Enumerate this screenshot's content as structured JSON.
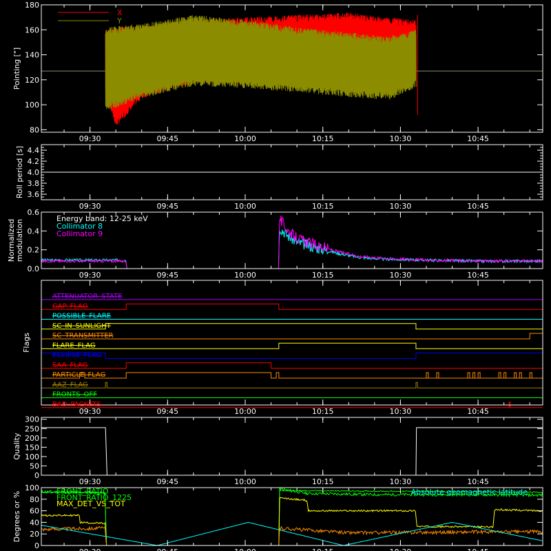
{
  "x_axis": {
    "ticks": [
      "09:30",
      "09:45",
      "10:00",
      "10:15",
      "10:30",
      "10:45"
    ],
    "tick_minutes": [
      570,
      585,
      600,
      615,
      630,
      645
    ],
    "xlim_minutes": [
      560.6,
      657.5
    ]
  },
  "colors": {
    "red": "#ff0000",
    "olive": "#8c8c00",
    "white": "#ffffff",
    "cyan": "#00ffff",
    "magenta": "#ff00ff",
    "yellow": "#ffff00",
    "orange": "#ff8c00",
    "blue": "#0000ff",
    "green": "#00ff00",
    "purple": "#b000ff",
    "dark_olive": "#a08000",
    "axis": "#ffffff"
  },
  "panels": {
    "pointing": {
      "ylabel": "Pointing [\"]",
      "yticks": [
        "80",
        "100",
        "120",
        "140",
        "160",
        "180"
      ],
      "ylim": [
        78,
        180
      ],
      "legend": [
        {
          "label": "X",
          "color": "#ff0000"
        },
        {
          "label": "Y",
          "color": "#8c8c00"
        }
      ]
    },
    "roll": {
      "ylabel": "Roll period [s]",
      "yticks": [
        "3.6",
        "3.8",
        "4.0",
        "4.2",
        "4.4"
      ],
      "ylim": [
        3.5,
        4.5
      ]
    },
    "modulation": {
      "ylabel_line1": "Normalized",
      "ylabel_line2": "modulation",
      "yticks": [
        "0.0",
        "0.2",
        "0.4",
        "0.6"
      ],
      "ylim": [
        0,
        0.6
      ],
      "legend": [
        {
          "label": "Energy band: 12-25 keV",
          "color": "#ffffff"
        },
        {
          "label": "Collimator 8",
          "color": "#00ffff"
        },
        {
          "label": "Collimator 9",
          "color": "#ff00ff"
        }
      ]
    },
    "flags": {
      "ylabel": "Flags",
      "items": [
        {
          "label": "ATTENUATOR_STATE",
          "color": "#b000ff"
        },
        {
          "label": "GAP_FLAG",
          "color": "#ff0000"
        },
        {
          "label": "POSSIBLE_FLARE",
          "color": "#00ffff"
        },
        {
          "label": "SC_IN_SUNLIGHT",
          "color": "#ffff00"
        },
        {
          "label": "SC_TRANSMITTER",
          "color": "#ff8c00"
        },
        {
          "label": "FLARE_FLAG",
          "color": "#ffff00"
        },
        {
          "label": "ECLIPSE_FLAG",
          "color": "#0000ff"
        },
        {
          "label": "SAA_FLAG",
          "color": "#ff0000"
        },
        {
          "label": "PARTICLE_FLAG",
          "color": "#ff8c00"
        },
        {
          "label": "AAZ_FLAG",
          "color": "#a08000"
        },
        {
          "label": "FRONTS_OFF",
          "color": "#00ff00"
        },
        {
          "label": "BAD_PACKETS",
          "color": "#ff0000"
        }
      ]
    },
    "quality": {
      "ylabel": "Quality",
      "yticks": [
        "0",
        "50",
        "100",
        "150",
        "200",
        "250",
        "300"
      ],
      "ylim": [
        0,
        310
      ]
    },
    "ratio": {
      "ylabel": "Degrees or %",
      "yticks": [
        "0",
        "20",
        "40",
        "60",
        "80",
        "100"
      ],
      "ylim": [
        0,
        100
      ],
      "legend": [
        {
          "label": "FRONT_RATIO",
          "color": "#00ff00"
        },
        {
          "label": "FRONT_RATIO_1225",
          "color": "#00ff00"
        },
        {
          "label": "MAX_DET_VS_TOT",
          "color": "#ffff00"
        }
      ],
      "annotation": {
        "label": "Absolute geomagnetic latitude",
        "color": "#00ffff"
      }
    }
  },
  "chart_data": [
    {
      "type": "line",
      "ylabel": "Pointing [\"]",
      "ylim": [
        78,
        180
      ],
      "x_unit": "minutes since 00:00",
      "series": [
        {
          "name": "X",
          "envelope_x": [
            573,
            575,
            580,
            590,
            600,
            610,
            620,
            627,
            633
          ],
          "envelope_hi": [
            160,
            162,
            163,
            168,
            170,
            172,
            174,
            170,
            168
          ],
          "envelope_lo": [
            108,
            82,
            105,
            118,
            117,
            120,
            122,
            128,
            121
          ]
        },
        {
          "name": "Y",
          "envelope_x": [
            573,
            580,
            590,
            600,
            610,
            620,
            628,
            633
          ],
          "envelope_hi": [
            162,
            165,
            172,
            168,
            162,
            158,
            155,
            160
          ],
          "envelope_lo": [
            95,
            105,
            115,
            113,
            110,
            106,
            104,
            114
          ]
        }
      ],
      "reference_line": 127
    },
    {
      "type": "line",
      "ylabel": "Roll period [s]",
      "ylim": [
        3.5,
        4.5
      ],
      "series": [
        {
          "x": [
            560.6,
            657.5
          ],
          "values": [
            4.0,
            4.0
          ]
        }
      ]
    },
    {
      "type": "line",
      "ylabel": "Normalized modulation",
      "ylim": [
        0,
        0.6
      ],
      "series": [
        {
          "name": "Collimator 8",
          "x": [
            560.6,
            577,
            577.1,
            606.5,
            606.6,
            607,
            608,
            610,
            614,
            618,
            622,
            627,
            635,
            645,
            657.5
          ],
          "values": [
            0.09,
            0.09,
            0,
            0,
            0.45,
            0.42,
            0.36,
            0.28,
            0.22,
            0.16,
            0.12,
            0.1,
            0.09,
            0.08,
            0.08
          ]
        },
        {
          "name": "Collimator 9",
          "x": [
            560.6,
            577,
            577.1,
            606.5,
            606.6,
            607,
            608,
            610,
            614,
            618,
            622,
            627,
            635,
            645,
            657.5
          ],
          "values": [
            0.08,
            0.08,
            0,
            0,
            0.55,
            0.5,
            0.42,
            0.32,
            0.24,
            0.18,
            0.13,
            0.11,
            0.09,
            0.08,
            0.08
          ]
        }
      ]
    },
    {
      "type": "line",
      "ylabel": "Flags",
      "series": [
        {
          "name": "ATTENUATOR_STATE",
          "steps": [
            [
              560.6,
              0
            ],
            [
              657.5,
              0
            ]
          ]
        },
        {
          "name": "GAP_FLAG",
          "steps": [
            [
              560.6,
              0
            ],
            [
              577,
              1
            ],
            [
              606.5,
              0
            ],
            [
              657.5,
              0
            ]
          ]
        },
        {
          "name": "POSSIBLE_FLARE",
          "steps": [
            [
              560.6,
              0
            ],
            [
              657.5,
              0
            ]
          ]
        },
        {
          "name": "SC_IN_SUNLIGHT",
          "steps": [
            [
              560.6,
              0
            ],
            [
              573,
              1
            ],
            [
              633,
              0
            ],
            [
              657.5,
              0
            ]
          ]
        },
        {
          "name": "SC_TRANSMITTER",
          "steps": [
            [
              560.6,
              0
            ],
            [
              655,
              1
            ],
            [
              657.5,
              1
            ]
          ]
        },
        {
          "name": "FLARE_FLAG",
          "steps": [
            [
              560.6,
              0
            ],
            [
              606.5,
              1
            ],
            [
              633,
              0
            ],
            [
              657.5,
              0
            ]
          ]
        },
        {
          "name": "ECLIPSE_FLAG",
          "steps": [
            [
              560.6,
              1
            ],
            [
              573,
              0
            ],
            [
              633,
              1
            ],
            [
              657.5,
              1
            ]
          ]
        },
        {
          "name": "SAA_FLAG",
          "steps": [
            [
              560.6,
              0
            ],
            [
              577,
              1
            ],
            [
              605,
              0
            ],
            [
              657.5,
              0
            ]
          ]
        },
        {
          "name": "PARTICLE_FLAG",
          "steps": [
            [
              560.6,
              0
            ],
            [
              568,
              1
            ],
            [
              569,
              0
            ],
            [
              577,
              1
            ],
            [
              605,
              0
            ],
            [
              606,
              1
            ],
            [
              606.5,
              0
            ],
            [
              657.5,
              0
            ]
          ]
        },
        {
          "name": "AAZ_FLAG",
          "steps": [
            [
              560.6,
              0
            ],
            [
              573,
              1
            ],
            [
              573.3,
              0
            ],
            [
              633,
              1
            ],
            [
              633.3,
              0
            ],
            [
              657.5,
              0
            ]
          ]
        },
        {
          "name": "FRONTS_OFF",
          "steps": [
            [
              560.6,
              0
            ],
            [
              657.5,
              0
            ]
          ]
        },
        {
          "name": "BAD_PACKETS",
          "steps": [
            [
              560.6,
              0
            ],
            [
              651,
              1
            ],
            [
              651.2,
              0
            ],
            [
              657.5,
              0
            ]
          ]
        }
      ]
    },
    {
      "type": "line",
      "ylabel": "Quality",
      "ylim": [
        0,
        310
      ],
      "series": [
        {
          "x": [
            560.6,
            573,
            573.3,
            633,
            633.1,
            657.5
          ],
          "values": [
            255,
            255,
            0,
            0,
            255,
            255
          ]
        }
      ]
    },
    {
      "type": "line",
      "ylabel": "Degrees or %",
      "ylim": [
        0,
        100
      ],
      "series": [
        {
          "name": "FRONT_RATIO",
          "x": [
            560.6,
            570,
            573,
            573.1,
            606.5,
            606.6,
            612,
            625,
            640,
            657.5
          ],
          "values": [
            93,
            92,
            90,
            0,
            0,
            98,
            90,
            88,
            88,
            87
          ]
        },
        {
          "name": "FRONT_RATIO_1225",
          "x": [
            560.6,
            573,
            573.1,
            606.5,
            606.6,
            657.5
          ],
          "values": [
            92,
            91,
            0,
            0,
            95,
            92
          ]
        },
        {
          "name": "MAX_DET_VS_TOT",
          "x": [
            560.6,
            568,
            568.1,
            573,
            573.1,
            606.5,
            606.6,
            612,
            612.1,
            633,
            633.1,
            648,
            648.1,
            657.5
          ],
          "values": [
            52,
            52,
            40,
            38,
            0,
            0,
            82,
            78,
            60,
            60,
            33,
            32,
            62,
            60
          ]
        },
        {
          "name": "Orange",
          "x": [
            560.6,
            573,
            573.1,
            606.5,
            606.6,
            620,
            657.5
          ],
          "values": [
            28,
            30,
            0,
            0,
            30,
            22,
            24
          ]
        },
        {
          "name": "Absolute geomagnetic latitude",
          "x": [
            560.6,
            583,
            600.6,
            619,
            640,
            657.5
          ],
          "values": [
            35,
            0,
            40,
            0,
            40,
            8
          ]
        }
      ]
    }
  ]
}
